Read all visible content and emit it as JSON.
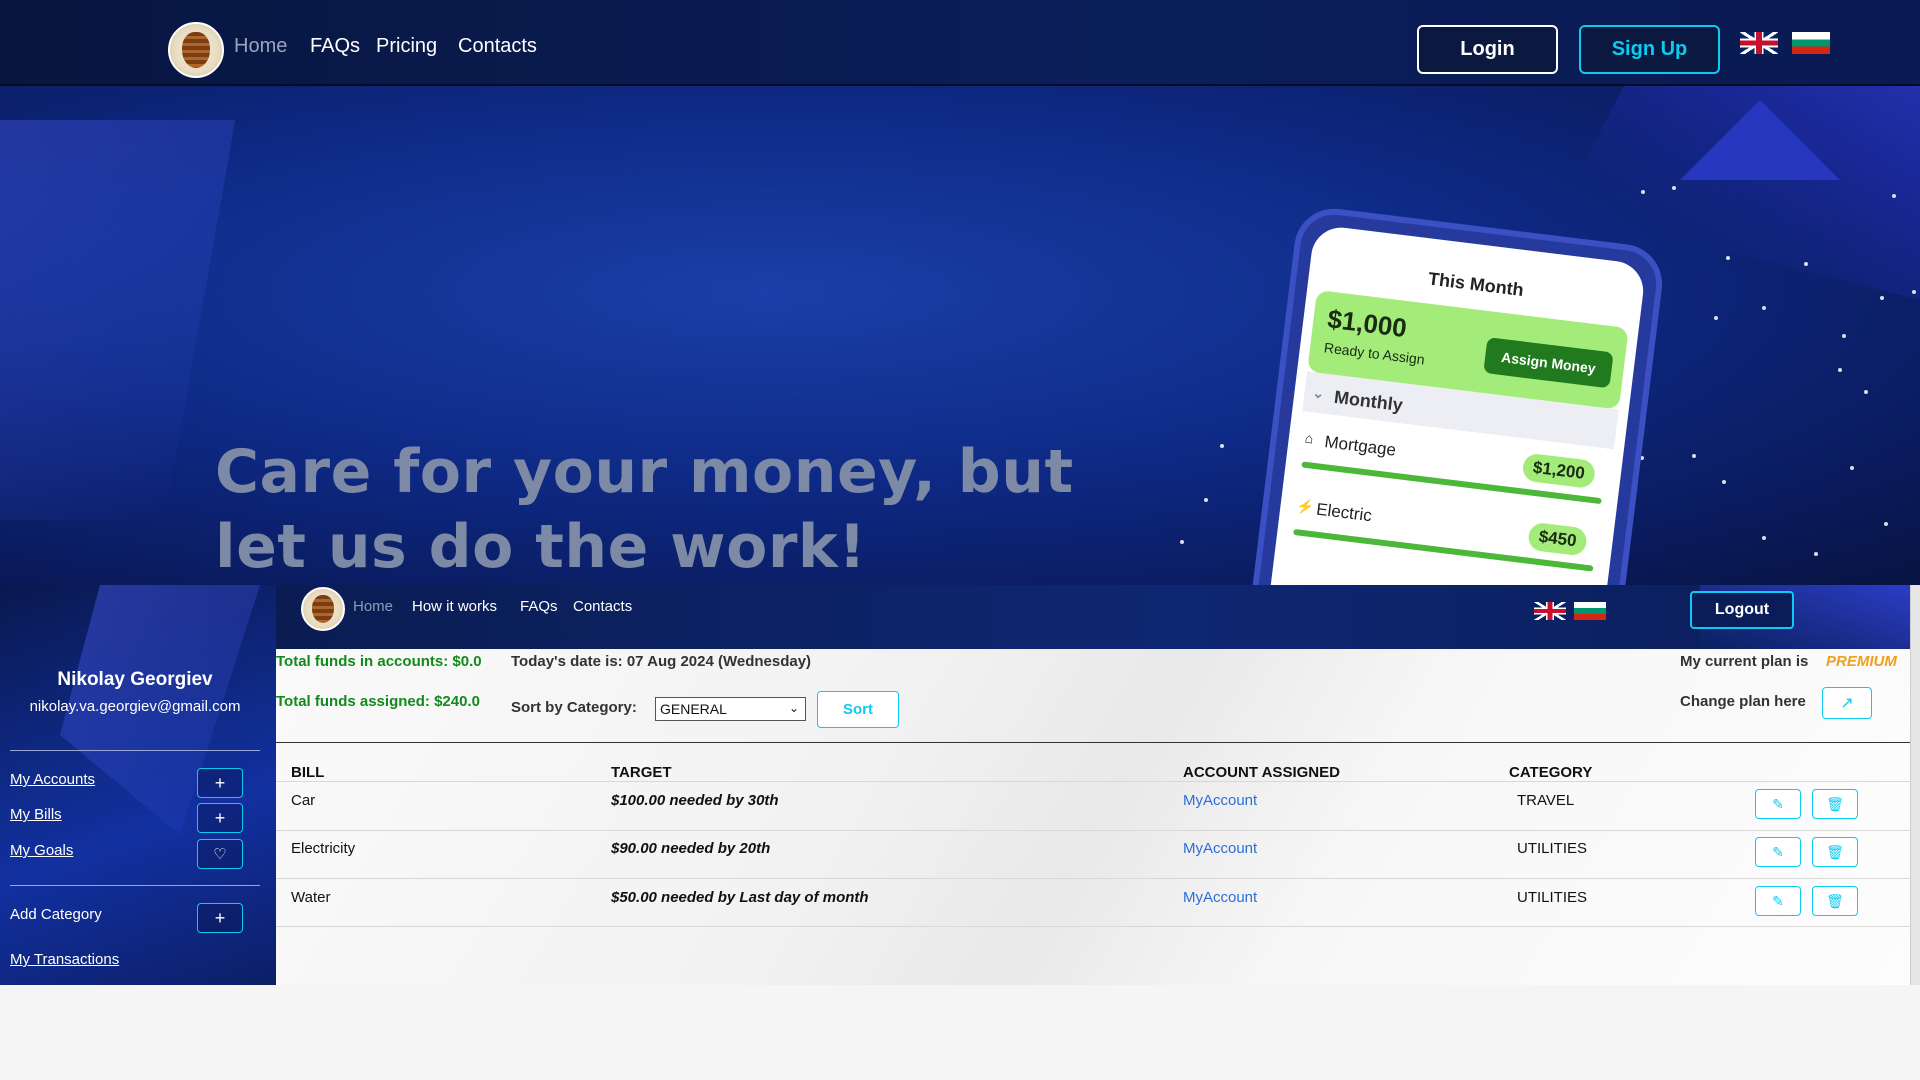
{
  "hero": {
    "nav": {
      "home": "Home",
      "faqs": "FAQs",
      "pricing": "Pricing",
      "contacts": "Contacts"
    },
    "login": "Login",
    "signup": "Sign Up",
    "title_line1": "Care for your money, but",
    "title_line2": "let us do the work!",
    "phone": {
      "title": "This Month",
      "amount": "$1,000",
      "ready": "Ready to Assign",
      "assign": "Assign Money",
      "monthly": "Monthly",
      "rows": [
        {
          "label": "Mortgage",
          "amount": "$1,200"
        },
        {
          "label": "Electric",
          "amount": "$450"
        }
      ]
    }
  },
  "app": {
    "nav": {
      "home": "Home",
      "how": "How it works",
      "faqs": "FAQs",
      "contacts": "Contacts"
    },
    "logout": "Logout",
    "user": {
      "name": "Nikolay Georgiev",
      "email": "nikolay.va.georgiev@gmail.com"
    },
    "sidebar": {
      "accounts": "My Accounts",
      "bills": "My Bills",
      "goals": "My Goals",
      "add_category": "Add Category",
      "transactions": "My Transactions"
    },
    "summary": {
      "funds_accounts": "Total funds in accounts: $0.0",
      "funds_assigned": "Total funds assigned: $240.0",
      "date": "Today's date is: 07 Aug 2024 (Wednesday)",
      "sort_label": "Sort by Category:",
      "sort_value": "GENERAL",
      "sort_button": "Sort",
      "plan_label": "My current plan is",
      "plan_value": "PREMIUM",
      "change_plan": "Change plan here"
    },
    "table": {
      "headers": {
        "bill": "BILL",
        "target": "TARGET",
        "account": "ACCOUNT ASSIGNED",
        "category": "CATEGORY"
      },
      "rows": [
        {
          "bill": "Car",
          "target": "$100.00 needed by 30th",
          "account": "MyAccount",
          "category": "TRAVEL"
        },
        {
          "bill": "Electricity",
          "target": "$90.00 needed by 20th",
          "account": "MyAccount",
          "category": "UTILITIES"
        },
        {
          "bill": "Water",
          "target": "$50.00 needed by Last day of month",
          "account": "MyAccount",
          "category": "UTILITIES"
        }
      ]
    },
    "colors": {
      "accent": "#0dcaf0",
      "green": "#138a1b",
      "premium": "#f0a01a",
      "link": "#2b6fd6"
    }
  }
}
